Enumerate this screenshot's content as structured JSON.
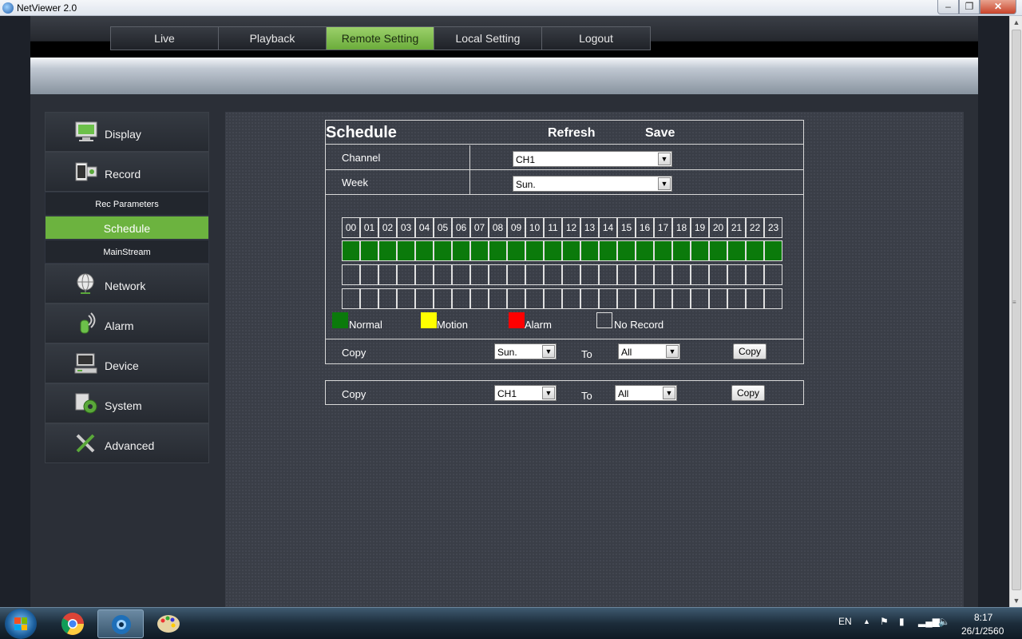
{
  "window": {
    "title": "NetViewer 2.0"
  },
  "nav": {
    "tabs": [
      {
        "label": "Live",
        "active": false
      },
      {
        "label": "Playback",
        "active": false
      },
      {
        "label": "Remote Setting",
        "active": true
      },
      {
        "label": "Local Setting",
        "active": false
      },
      {
        "label": "Logout",
        "active": false
      }
    ]
  },
  "sidebar": {
    "items": [
      {
        "label": "Display",
        "icon": "monitor-icon"
      },
      {
        "label": "Record",
        "icon": "film-icon"
      },
      {
        "label": "Network",
        "icon": "globe-icon"
      },
      {
        "label": "Alarm",
        "icon": "alarm-icon"
      },
      {
        "label": "Device",
        "icon": "computer-icon"
      },
      {
        "label": "System",
        "icon": "gear-icon"
      },
      {
        "label": "Advanced",
        "icon": "tools-icon"
      }
    ],
    "sub_items": [
      {
        "label": "Rec Parameters",
        "active": false
      },
      {
        "label": "Schedule",
        "active": true
      },
      {
        "label": "MainStream",
        "active": false
      }
    ]
  },
  "schedule": {
    "title": "Schedule",
    "refresh": "Refresh",
    "save": "Save",
    "channel_label": "Channel",
    "channel_value": "CH1",
    "week_label": "Week",
    "week_value": "Sun.",
    "hours": [
      "00",
      "01",
      "02",
      "03",
      "04",
      "05",
      "06",
      "07",
      "08",
      "09",
      "10",
      "11",
      "12",
      "13",
      "14",
      "15",
      "16",
      "17",
      "18",
      "19",
      "20",
      "21",
      "22",
      "23"
    ],
    "rows": [
      [
        "normal",
        "normal",
        "normal",
        "normal",
        "normal",
        "normal",
        "normal",
        "normal",
        "normal",
        "normal",
        "normal",
        "normal",
        "normal",
        "normal",
        "normal",
        "normal",
        "normal",
        "normal",
        "normal",
        "normal",
        "normal",
        "normal",
        "normal",
        "normal"
      ],
      [
        "none",
        "none",
        "none",
        "none",
        "none",
        "none",
        "none",
        "none",
        "none",
        "none",
        "none",
        "none",
        "none",
        "none",
        "none",
        "none",
        "none",
        "none",
        "none",
        "none",
        "none",
        "none",
        "none",
        "none"
      ],
      [
        "none",
        "none",
        "none",
        "none",
        "none",
        "none",
        "none",
        "none",
        "none",
        "none",
        "none",
        "none",
        "none",
        "none",
        "none",
        "none",
        "none",
        "none",
        "none",
        "none",
        "none",
        "none",
        "none",
        "none"
      ]
    ],
    "legend": [
      {
        "label": "Normal",
        "color": "#0b7a0b"
      },
      {
        "label": "Motion",
        "color": "#ffff00"
      },
      {
        "label": "Alarm",
        "color": "#ff0000"
      },
      {
        "label": "No Record",
        "color": "transparent"
      }
    ],
    "copy_week": {
      "label": "Copy",
      "from": "Sun.",
      "to_label": "To",
      "to": "All",
      "button": "Copy"
    },
    "copy_channel": {
      "label": "Copy",
      "from": "CH1",
      "to_label": "To",
      "to": "All",
      "button": "Copy"
    }
  },
  "taskbar": {
    "lang": "EN",
    "time": "8:17",
    "date": "26/1/2560"
  }
}
